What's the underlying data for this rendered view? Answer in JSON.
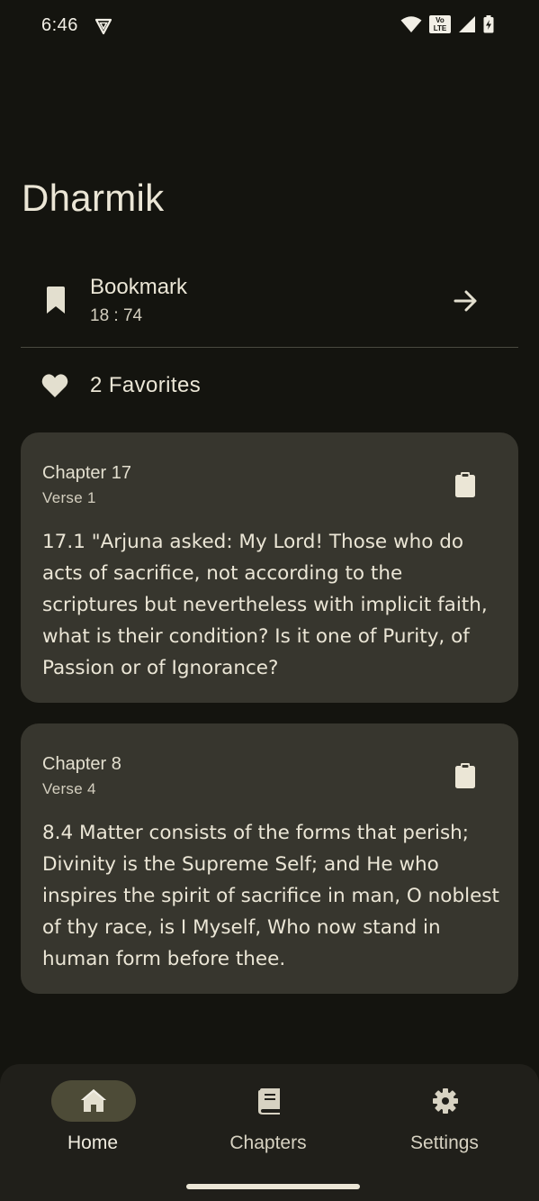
{
  "status_bar": {
    "time": "6:46",
    "icons": [
      "vpn-icon",
      "wifi-icon",
      "volte-icon",
      "signal-icon",
      "battery-charging-icon"
    ],
    "volte_label": "Vo\nLTE"
  },
  "app": {
    "title": "Dharmik"
  },
  "bookmark": {
    "label": "Bookmark",
    "value": "18 : 74",
    "icon": "bookmark-icon",
    "action_icon": "arrow-right-icon"
  },
  "favorites": {
    "label": "2 Favorites",
    "icon": "heart-icon"
  },
  "cards": [
    {
      "chapter": "Chapter 17",
      "verse": "Verse 1",
      "text": "17.1 \"Arjuna asked: My Lord! Those who do acts of sacrifice, not according to the scriptures but nevertheless with implicit faith, what is their condition? Is it one of Purity, of Passion or of Ignorance?",
      "icon": "clipboard-icon"
    },
    {
      "chapter": "Chapter 8",
      "verse": "Verse 4",
      "text": "8.4 Matter consists of the forms that perish; Divinity is the Supreme Self; and He who inspires the spirit of sacrifice in man, O noblest of thy race, is I Myself, Who now stand in human form before thee.",
      "icon": "clipboard-icon"
    }
  ],
  "bottom_nav": {
    "items": [
      {
        "label": "Home",
        "icon": "home-icon",
        "active": true
      },
      {
        "label": "Chapters",
        "icon": "book-icon",
        "active": false
      },
      {
        "label": "Settings",
        "icon": "gear-icon",
        "active": false
      }
    ]
  },
  "colors": {
    "background": "#14140f",
    "card": "#37362e",
    "nav_background": "#201f1a",
    "active_pill": "#4d4b37",
    "text": "#ebe6d6"
  }
}
